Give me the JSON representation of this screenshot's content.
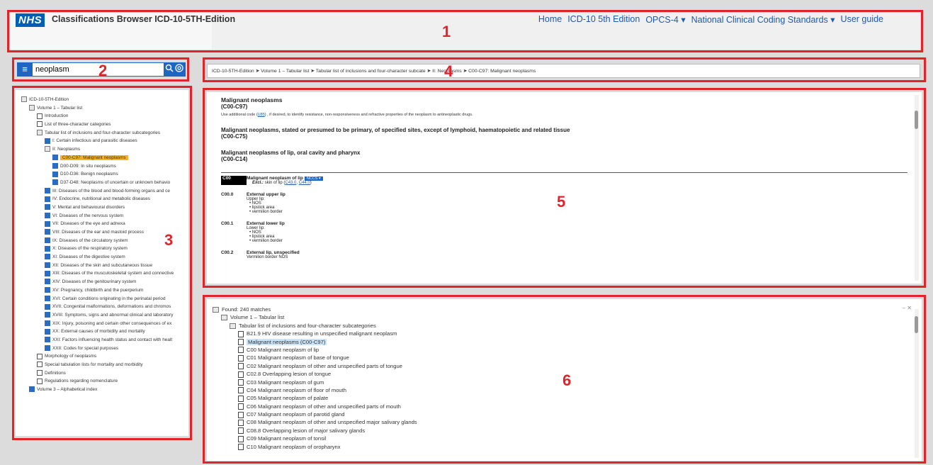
{
  "header": {
    "logo": "NHS",
    "title": "Classifications Browser ICD-10-5TH-Edition",
    "nav": [
      "Home",
      "ICD-10 5th Edition",
      "OPCS-4 ▾",
      "National Clinical Coding Standards ▾",
      "User guide"
    ]
  },
  "search": {
    "value": "neoplasm",
    "filter_icon": "filter-icon",
    "search_icon": "search-icon",
    "advanced_icon": "advanced-search-icon"
  },
  "tree": {
    "items": [
      {
        "label": "ICD-10-5TH-Edition",
        "indent": 0,
        "icon": "folder"
      },
      {
        "label": "Volume 1 – Tabular list",
        "indent": 1,
        "icon": "folder"
      },
      {
        "label": "Introduction",
        "indent": 2,
        "icon": "doc"
      },
      {
        "label": "List of three-character categories",
        "indent": 2,
        "icon": "doc"
      },
      {
        "label": "Tabular list of inclusions and four-character subcategories",
        "indent": 2,
        "icon": "folder"
      },
      {
        "label": "I: Certain infectious and parasitic diseases",
        "indent": 3,
        "icon": "book"
      },
      {
        "label": "II: Neoplasms",
        "indent": 3,
        "icon": "folder"
      },
      {
        "label": "C00-C97: Malignant neoplasms",
        "indent": 4,
        "icon": "book",
        "selected": true
      },
      {
        "label": "D00-D09: In situ neoplasms",
        "indent": 4,
        "icon": "book"
      },
      {
        "label": "D10-D36: Benign neoplasms",
        "indent": 4,
        "icon": "book"
      },
      {
        "label": "D37-D48: Neoplasms of uncertain or unknown behavio",
        "indent": 4,
        "icon": "book"
      },
      {
        "label": "III: Diseases of the blood and blood-forming organs and ce",
        "indent": 3,
        "icon": "book"
      },
      {
        "label": "IV: Endocrine, nutritional and metabolic diseases",
        "indent": 3,
        "icon": "book"
      },
      {
        "label": "V: Mental and behavioural disorders",
        "indent": 3,
        "icon": "book"
      },
      {
        "label": "VI: Diseases of the nervous system",
        "indent": 3,
        "icon": "book"
      },
      {
        "label": "VII: Diseases of the eye and adnexa",
        "indent": 3,
        "icon": "book"
      },
      {
        "label": "VIII: Diseases of the ear and mastoid process",
        "indent": 3,
        "icon": "book"
      },
      {
        "label": "IX: Diseases of the circulatory system",
        "indent": 3,
        "icon": "book"
      },
      {
        "label": "X: Diseases of the respiratory system",
        "indent": 3,
        "icon": "book"
      },
      {
        "label": "XI: Diseases of the digestive system",
        "indent": 3,
        "icon": "book"
      },
      {
        "label": "XII: Diseases of the skin and subcutaneous tissue",
        "indent": 3,
        "icon": "book"
      },
      {
        "label": "XIII: Diseases of the musculoskeletal system and connective",
        "indent": 3,
        "icon": "book"
      },
      {
        "label": "XIV: Diseases of the genitourinary system",
        "indent": 3,
        "icon": "book"
      },
      {
        "label": "XV: Pregnancy, childbirth and the puerperium",
        "indent": 3,
        "icon": "book"
      },
      {
        "label": "XVI: Certain conditions originating in the perinatal period",
        "indent": 3,
        "icon": "book"
      },
      {
        "label": "XVII: Congenital malformations, deformations and chromos",
        "indent": 3,
        "icon": "book"
      },
      {
        "label": "XVIII: Symptoms, signs and abnormal clinical and laboratory",
        "indent": 3,
        "icon": "book"
      },
      {
        "label": "XIX: Injury, poisoning and certain other consequences of ex",
        "indent": 3,
        "icon": "book"
      },
      {
        "label": "XX: External causes of morbidity and mortality",
        "indent": 3,
        "icon": "book"
      },
      {
        "label": "XXI: Factors influencing health status and contact with healt",
        "indent": 3,
        "icon": "book"
      },
      {
        "label": "XXII: Codes for special purposes",
        "indent": 3,
        "icon": "book"
      },
      {
        "label": "Morphology of neoplasms",
        "indent": 2,
        "icon": "doc"
      },
      {
        "label": "Special tabulation lists for mortality and morbidity",
        "indent": 2,
        "icon": "doc"
      },
      {
        "label": "Definitions",
        "indent": 2,
        "icon": "doc"
      },
      {
        "label": "Regulations regarding nomenclature",
        "indent": 2,
        "icon": "doc"
      },
      {
        "label": "Volume 3 – Alphabetical index",
        "indent": 1,
        "icon": "book"
      }
    ]
  },
  "breadcrumb": "ICD-10-5TH-Edition ➤ Volume 1 – Tabular list ➤ Tabular list of inclusions and four-character subcate ➤ II: Neoplasms ➤ C00-C97: Malignant neoplasms",
  "content": {
    "h1": "Malignant neoplasms",
    "h1_code": "(C00-C97)",
    "note_prefix": "Use additional code (",
    "note_link": "U85",
    "note_suffix": ") , if desired, to identify resistance, non-responsiveness and refractive properties of the neoplasm to antineoplastic drugs.",
    "h2": "Malignant neoplasms, stated or presumed to be primary, of specified sites, except of lymphoid, haematopoietic and related tissue",
    "h2_code": "(C00-C75)",
    "h3": "Malignant neoplasms of lip, oral cavity and pharynx",
    "h3_code": "(C00-C14)",
    "block_code": "C00",
    "block_title": "Malignant neoplasm of lip",
    "nccs": "NCCS ▾",
    "excl_label": "Excl.:",
    "excl_text": "skin of lip (",
    "excl_link1": "C43.0",
    "excl_link2": "C44.0",
    "codes": [
      {
        "code": "C00.0",
        "title": "External upper lip",
        "sub": "Upper lip:",
        "bullets": [
          "NOS",
          "lipstick area",
          "vermilion border"
        ]
      },
      {
        "code": "C00.1",
        "title": "External lower lip",
        "sub": "Lower lip:",
        "bullets": [
          "NOS",
          "lipstick area",
          "vermilion border"
        ]
      },
      {
        "code": "C00.2",
        "title": "External lip, unspecified",
        "sub": "Vermilion border NOS",
        "bullets": []
      }
    ]
  },
  "results": {
    "found": "Found: 240 matches",
    "volume": "Volume 1 – Tabular list",
    "section": "Tabular list of inclusions and four-character subcategories",
    "items": [
      "B21.9 HIV disease resulting in unspecified malignant neoplasm",
      "Malignant neoplasms (C00-C97)",
      "C00 Malignant neoplasm of lip",
      "C01 Malignant neoplasm of base of tongue",
      "C02 Malignant neoplasm of other and unspecified parts of tongue",
      "C02.8 Overlapping lesion of tongue",
      "C03 Malignant neoplasm of gum",
      "C04 Malignant neoplasm of floor of mouth",
      "C05 Malignant neoplasm of palate",
      "C06 Malignant neoplasm of other and unspecified parts of mouth",
      "C07 Malignant neoplasm of parotid gland",
      "C08 Malignant neoplasm of other and unspecified major salivary glands",
      "C08.8 Overlapping lesion of major salivary glands",
      "C09 Malignant neoplasm of tonsil",
      "C10 Malignant neoplasm of oropharynx"
    ],
    "selected_index": 1
  },
  "annotations": [
    "1",
    "2",
    "3",
    "4",
    "5",
    "6"
  ]
}
